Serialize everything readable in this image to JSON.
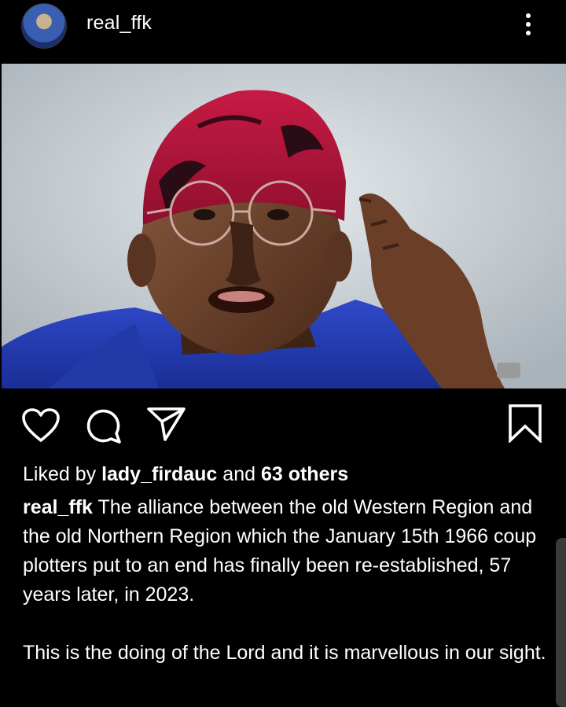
{
  "post": {
    "username": "real_ffk",
    "icons": {
      "more": "more-vertical-icon",
      "like": "heart-icon",
      "comment": "comment-icon",
      "share": "send-icon",
      "save": "bookmark-icon"
    },
    "likes": {
      "prefix": "Liked by ",
      "user": "lady_firdauc",
      "middle": " and ",
      "others": "63 others"
    },
    "caption": {
      "user": "real_ffk",
      "text": " The alliance between the old Western Region and the old Northern Region  which the January 15th 1966 coup plotters put to an end has finally been re-established, 57 years later, in 2023.\n\nThis is the doing of the Lord and it is marvellous in our sight."
    }
  }
}
